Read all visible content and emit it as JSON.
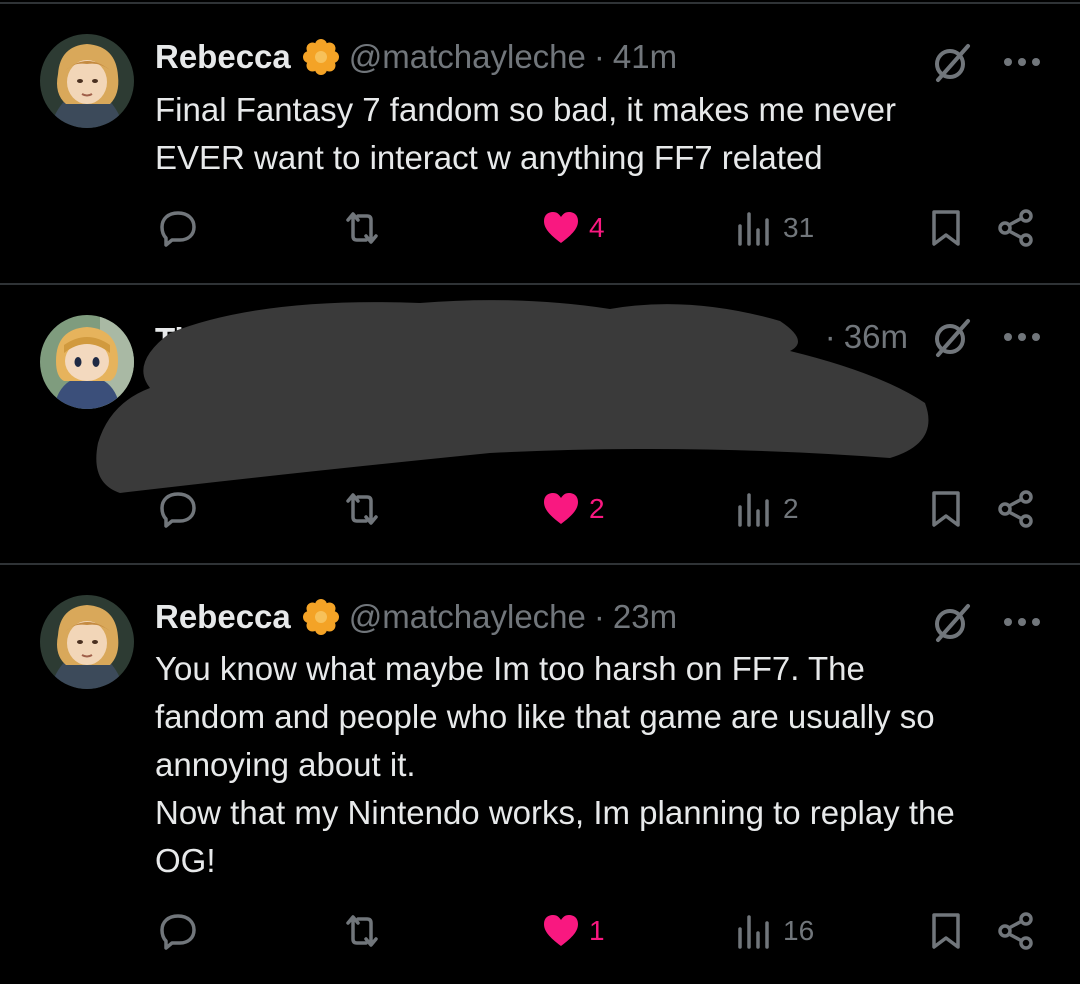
{
  "tweets": [
    {
      "name": "Rebecca",
      "handle": "@matchayleche",
      "separator": "·",
      "time": "41m",
      "text": "Final Fantasy 7 fandom so bad, it makes me never\nEVER want to interact w anything FF7 related",
      "likes": "4",
      "views": "31",
      "liked": true
    },
    {
      "name": "Ti",
      "handle": "",
      "separator": "·",
      "time": "36m",
      "text": "",
      "likes": "2",
      "views": "2",
      "liked": true,
      "redacted": true
    },
    {
      "name": "Rebecca",
      "handle": "@matchayleche",
      "separator": "·",
      "time": "23m",
      "text": "You know what maybe Im too harsh on FF7. The\nfandom and people who like that game are usually so\nannoying about it.\nNow that my Nintendo works, Im planning to replay the\nOG!",
      "likes": "1",
      "views": "16",
      "liked": true
    }
  ],
  "colors": {
    "background": "#000000",
    "text": "#e7e9ea",
    "muted": "#71767b",
    "like": "#f91880",
    "badge": "#f4a326",
    "divider": "#2f3336",
    "redaction": "#3a3a3a"
  },
  "icons": [
    "reply-icon",
    "retweet-icon",
    "heart-icon",
    "views-icon",
    "bookmark-icon",
    "share-icon",
    "grok-icon",
    "more-icon",
    "verified-badge-icon"
  ]
}
